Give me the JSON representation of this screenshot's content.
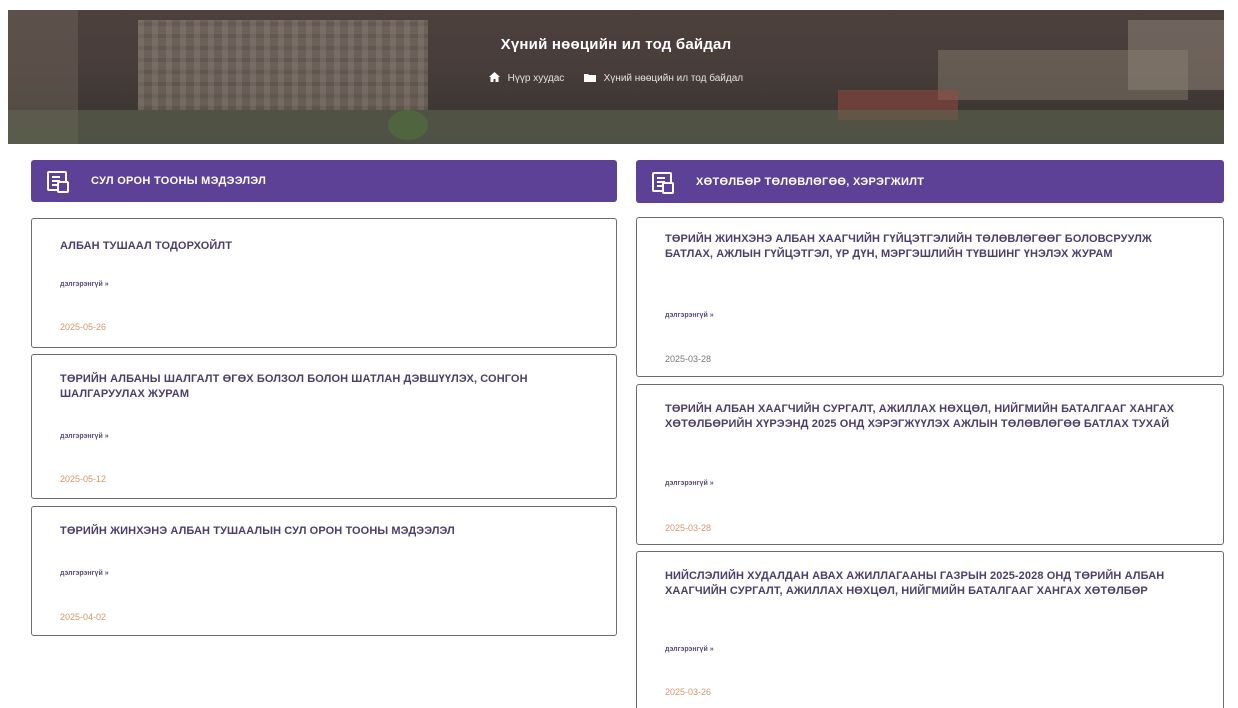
{
  "hero": {
    "title": "Хүний нөөцийн ил тод байдал",
    "breadcrumb": {
      "home_label": "Нүүр хуудас",
      "current_label": "Хүний нөөцийн ил тод байдал",
      "home_icon": "home-icon",
      "folder_icon": "folder-icon"
    }
  },
  "colors": {
    "accent": "#5c4197",
    "date": "#d4956a",
    "title": "#4b3e6a"
  },
  "left": {
    "heading": "СУЛ ОРОН ТООНЫ МЭДЭЭЛЭЛ",
    "heading_icon": "document-icon",
    "items": [
      {
        "title": "АЛБАН ТУШААЛ ТОДОРХОЙЛТ",
        "more": "дэлгэрэнгүй »",
        "date": "2025-05-26"
      },
      {
        "title": "ТӨРИЙН АЛБАНЫ ШАЛГАЛТ ӨГӨХ БОЛЗОЛ БОЛОН ШАТЛАН ДЭВШҮҮЛЭХ, СОНГОН ШАЛГАРУУЛАХ ЖУРАМ",
        "more": "дэлгэрэнгүй »",
        "date": "2025-05-12"
      },
      {
        "title": "ТӨРИЙН ЖИНХЭНЭ АЛБАН ТУШААЛЫН СУЛ ОРОН ТООНЫ МЭДЭЭЛЭЛ",
        "more": "дэлгэрэнгүй »",
        "date": "2025-04-02"
      }
    ]
  },
  "right": {
    "heading": "ХӨТӨЛБӨР ТӨЛӨВЛӨГӨӨ, ХЭРЭГЖИЛТ",
    "heading_icon": "document-icon",
    "items": [
      {
        "title": "ТӨРИЙН ЖИНХЭНЭ АЛБАН ХААГЧИЙН ГҮЙЦЭТГЭЛИЙН ТӨЛӨВЛӨГӨӨГ БОЛОВСРУУЛЖ БАТЛАХ, АЖЛЫН ГҮЙЦЭТГЭЛ, ҮР ДҮН, МЭРГЭШЛИЙН ТҮВШИНГ ҮНЭЛЭХ ЖУРАМ",
        "more": "дэлгэрэнгүй »",
        "date": "2025-03-28"
      },
      {
        "title": "ТӨРИЙН АЛБАН ХААГЧИЙН СУРГАЛТ, АЖИЛЛАХ НӨХЦӨЛ, НИЙГМИЙН БАТАЛГААГ ХАНГАХ ХӨТӨЛБӨРИЙН ХҮРЭЭНД 2025 ОНД ХЭРЭГЖҮҮЛЭХ АЖЛЫН ТӨЛӨВЛӨГӨӨ БАТЛАХ ТУХАЙ",
        "more": "дэлгэрэнгүй »",
        "date": "2025-03-28"
      },
      {
        "title": "НИЙСЛЭЛИЙН ХУДАЛДАН АВАХ АЖИЛЛАГААНЫ ГАЗРЫН 2025-2028 ОНД ТӨРИЙН АЛБАН ХААГЧИЙН СУРГАЛТ, АЖИЛЛАХ НӨХЦӨЛ, НИЙГМИЙН БАТАЛГААГ ХАНГАХ ХӨТӨЛБӨР",
        "more": "дэлгэрэнгүй »",
        "date": "2025-03-26"
      }
    ]
  }
}
